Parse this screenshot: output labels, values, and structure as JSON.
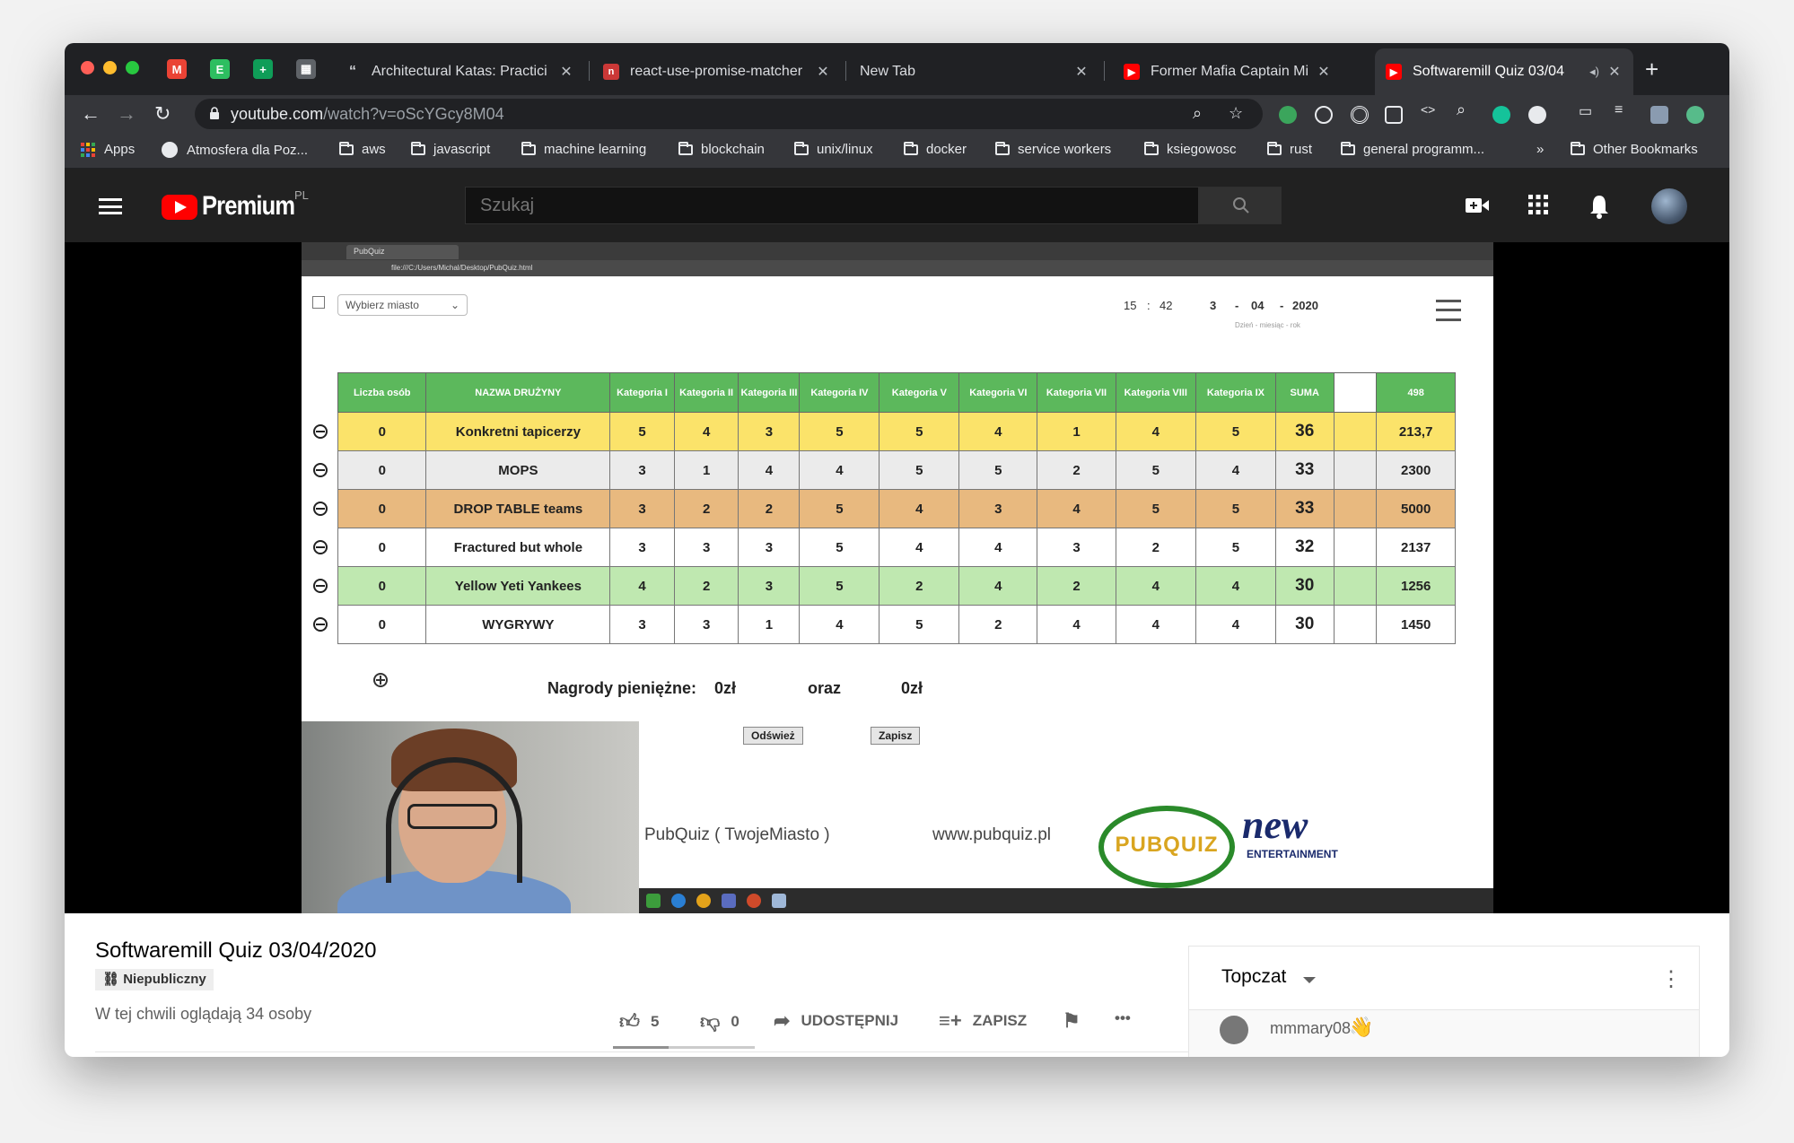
{
  "browser": {
    "tabs": [
      {
        "title": "Architectural Katas: Practici",
        "icon": "quote-icon"
      },
      {
        "title": "react-use-promise-matcher",
        "icon": "npm-icon"
      },
      {
        "title": "New Tab",
        "icon": ""
      },
      {
        "title": "Former Mafia Captain Micha",
        "icon": "youtube-icon"
      },
      {
        "title": "Softwaremill Quiz 03/04",
        "icon": "youtube-icon",
        "active": true
      }
    ],
    "url_host": "youtube.com",
    "url_path": "/watch?v=oScYGcy8M04",
    "bookmarks": [
      "Apps",
      "Atmosfera dla Poz...",
      "aws",
      "javascript",
      "machine learning",
      "blockchain",
      "unix/linux",
      "docker",
      "service workers",
      "ksiegowosc",
      "rust",
      "general programm..."
    ],
    "bookmarks_more": "»",
    "other_bookmarks": "Other Bookmarks"
  },
  "youtube": {
    "brand": "Premium",
    "region": "PL",
    "search_placeholder": "Szukaj"
  },
  "quiz": {
    "city_select": "Wybierz miasto",
    "time_h": "15",
    "time_m": "42",
    "time_sep": ":",
    "day": "3",
    "month": "04",
    "year": "2020",
    "date_sep": "-",
    "date_labels": "Dzień - miesiąc - rok",
    "headers": [
      "Liczba osób",
      "NAZWA DRUŻYNY",
      "Kategoria I",
      "Kategoria II",
      "Kategoria III",
      "Kategoria IV",
      "Kategoria V",
      "Kategoria VI",
      "Kategoria VII",
      "Kategoria VIII",
      "Kategoria IX",
      "SUMA",
      "",
      "498"
    ],
    "rows": [
      {
        "cls": "r-yellow",
        "cells": [
          "0",
          "Konkretni tapicerzy",
          "5",
          "4",
          "3",
          "5",
          "5",
          "4",
          "1",
          "4",
          "5",
          "36",
          "",
          "213,7"
        ]
      },
      {
        "cls": "r-gray",
        "cells": [
          "0",
          "MOPS",
          "3",
          "1",
          "4",
          "4",
          "5",
          "5",
          "2",
          "5",
          "4",
          "33",
          "",
          "2300"
        ]
      },
      {
        "cls": "r-orange",
        "cells": [
          "0",
          "DROP TABLE teams",
          "3",
          "2",
          "2",
          "5",
          "4",
          "3",
          "4",
          "5",
          "5",
          "33",
          "",
          "5000"
        ]
      },
      {
        "cls": "r-white",
        "cells": [
          "0",
          "Fractured but whole",
          "3",
          "3",
          "3",
          "5",
          "4",
          "4",
          "3",
          "2",
          "5",
          "32",
          "",
          "2137"
        ]
      },
      {
        "cls": "r-green",
        "cells": [
          "0",
          "Yellow Yeti Yankees",
          "4",
          "2",
          "3",
          "5",
          "2",
          "4",
          "2",
          "4",
          "4",
          "30",
          "",
          "1256"
        ]
      },
      {
        "cls": "r-white",
        "cells": [
          "0",
          "WYGRYWY",
          "3",
          "3",
          "1",
          "4",
          "5",
          "2",
          "4",
          "4",
          "4",
          "30",
          "",
          "1450"
        ]
      }
    ],
    "prize_label": "Nagrody pieniężne:",
    "prize_1": "0zł",
    "prize_join": "oraz",
    "prize_2": "0zł",
    "refresh_btn": "Odśwież",
    "save_btn": "Zapisz",
    "pubquiz_city": "PubQuiz ( TwojeMiasto )",
    "website": "www.pubquiz.pl",
    "logo_text": "PUBQUIZ",
    "new_logo": "new",
    "entertainment": "ENTERTAINMENT"
  },
  "video": {
    "title": "Softwaremill Quiz 03/04/2020",
    "privacy": "Niepubliczny",
    "watching": "W tej chwili oglądają 34 osoby",
    "likes": "5",
    "dislikes": "0",
    "like_ratio": 1.0,
    "share": "UDOSTĘPNIJ",
    "save": "ZAPISZ",
    "more": "•••"
  },
  "chat": {
    "title": "Topczat",
    "user": "mmmary08",
    "emoji": "👋"
  },
  "colors": {
    "tab_bg": "#202124",
    "toolbar_bg": "#35363a",
    "youtube_red": "#ff0000",
    "header_green": "#5cb85c"
  }
}
